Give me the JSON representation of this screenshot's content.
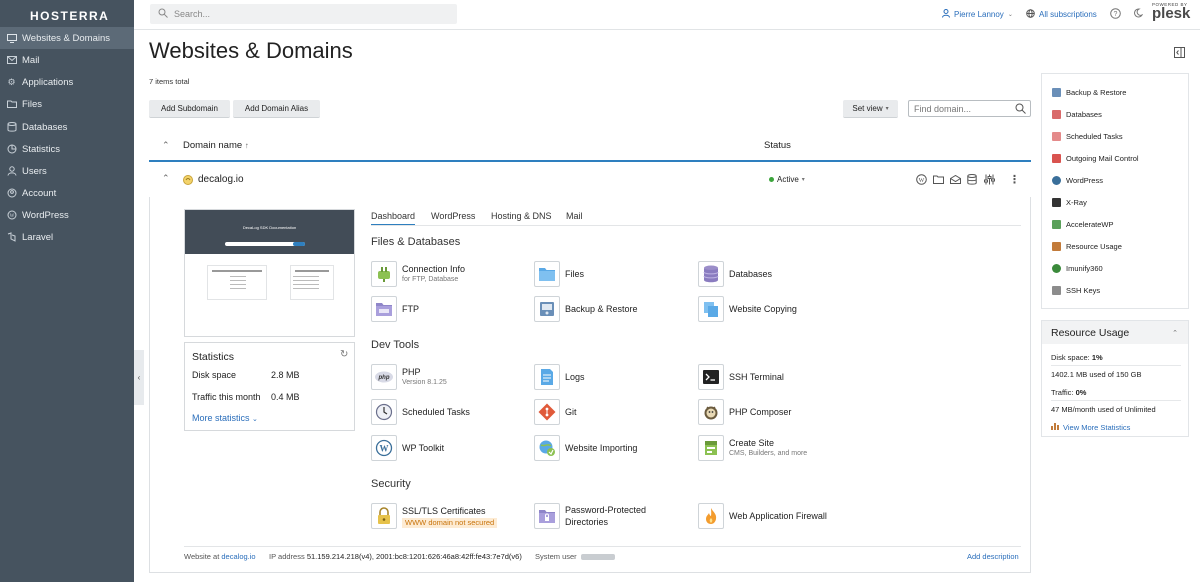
{
  "app": {
    "logo_text": "HOSTERRA",
    "powered_by": "POWERED BY",
    "brand": "plesk"
  },
  "sidebar": {
    "items": [
      {
        "label": "Websites & Domains",
        "icon": "monitor-icon",
        "active": true
      },
      {
        "label": "Mail",
        "icon": "mail-icon"
      },
      {
        "label": "Applications",
        "icon": "gear-icon"
      },
      {
        "label": "Files",
        "icon": "folder-icon"
      },
      {
        "label": "Databases",
        "icon": "database-icon"
      },
      {
        "label": "Statistics",
        "icon": "stats-icon"
      },
      {
        "label": "Users",
        "icon": "user-icon"
      },
      {
        "label": "Account",
        "icon": "account-icon"
      },
      {
        "label": "WordPress",
        "icon": "wordpress-icon"
      },
      {
        "label": "Laravel",
        "icon": "laravel-icon"
      }
    ]
  },
  "header": {
    "search_placeholder": "Search...",
    "user": "Pierre Lannoy",
    "subscriptions": "All subscriptions"
  },
  "main": {
    "title": "Websites & Domains",
    "items_total": "7 items total",
    "buttons": {
      "add_subdomain": "Add Subdomain",
      "add_domain_alias": "Add Domain Alias",
      "set_view": "Set view"
    },
    "find_placeholder": "Find domain...",
    "columns": {
      "domain": "Domain name",
      "status": "Status"
    }
  },
  "domain": {
    "name": "decalog.io",
    "status": "Active",
    "preview": {
      "title": "DecaLog SDK Documentation"
    },
    "stats": {
      "title": "Statistics",
      "disk_label": "Disk space",
      "disk_value": "2.8 MB",
      "traffic_label": "Traffic this month",
      "traffic_value": "0.4 MB",
      "more": "More statistics"
    },
    "tabs": [
      "Dashboard",
      "WordPress",
      "Hosting & DNS",
      "Mail"
    ],
    "sections": {
      "files": "Files & Databases",
      "dev": "Dev Tools",
      "security": "Security"
    },
    "tools": {
      "connection": {
        "label": "Connection Info",
        "sub": "for FTP, Database"
      },
      "files": {
        "label": "Files"
      },
      "databases": {
        "label": "Databases"
      },
      "ftp": {
        "label": "FTP"
      },
      "backup": {
        "label": "Backup & Restore"
      },
      "copying": {
        "label": "Website Copying"
      },
      "php": {
        "label": "PHP",
        "sub": "Version 8.1.25",
        "icon_text": "php"
      },
      "logs": {
        "label": "Logs"
      },
      "ssh": {
        "label": "SSH Terminal"
      },
      "tasks": {
        "label": "Scheduled Tasks"
      },
      "git": {
        "label": "Git"
      },
      "composer": {
        "label": "PHP Composer"
      },
      "wptoolkit": {
        "label": "WP Toolkit"
      },
      "importing": {
        "label": "Website Importing"
      },
      "create": {
        "label": "Create Site",
        "sub": "CMS, Builders, and more"
      },
      "ssl": {
        "label": "SSL/TLS Certificates",
        "warning": "WWW domain not secured"
      },
      "password": {
        "label": "Password-Protected Directories"
      },
      "waf": {
        "label": "Web Application Firewall"
      }
    },
    "footer": {
      "website_at": "Website at",
      "website_link": "decalog.io",
      "ip_label": "IP address",
      "ip_value": "51.159.214.218(v4), 2001:bc8:1201:626:46a8:42ff:fe43:7e7d(v6)",
      "system_user": "System user",
      "add_description": "Add description"
    }
  },
  "quick_links": [
    {
      "label": "Backup & Restore",
      "color": "#6a8fb8"
    },
    {
      "label": "Databases",
      "color": "#d96a6a"
    },
    {
      "label": "Scheduled Tasks",
      "color": "#e48a8a"
    },
    {
      "label": "Outgoing Mail Control",
      "color": "#d9534f"
    },
    {
      "label": "WordPress",
      "color": "#3a6f9a"
    },
    {
      "label": "X-Ray",
      "color": "#333333"
    },
    {
      "label": "AccelerateWP",
      "color": "#5aa05a"
    },
    {
      "label": "Resource Usage",
      "color": "#c27b3a"
    },
    {
      "label": "Imunify360",
      "color": "#3b8a3b"
    },
    {
      "label": "SSH Keys",
      "color": "#8c8c8c"
    }
  ],
  "resource_usage": {
    "title": "Resource Usage",
    "disk": "Disk space: ",
    "disk_pct": "1%",
    "disk_detail": "1402.1 MB used of 150 GB",
    "traffic": "Traffic: ",
    "traffic_pct": "0%",
    "traffic_detail": "47 MB/month used of Unlimited",
    "view_more": "View More Statistics"
  }
}
